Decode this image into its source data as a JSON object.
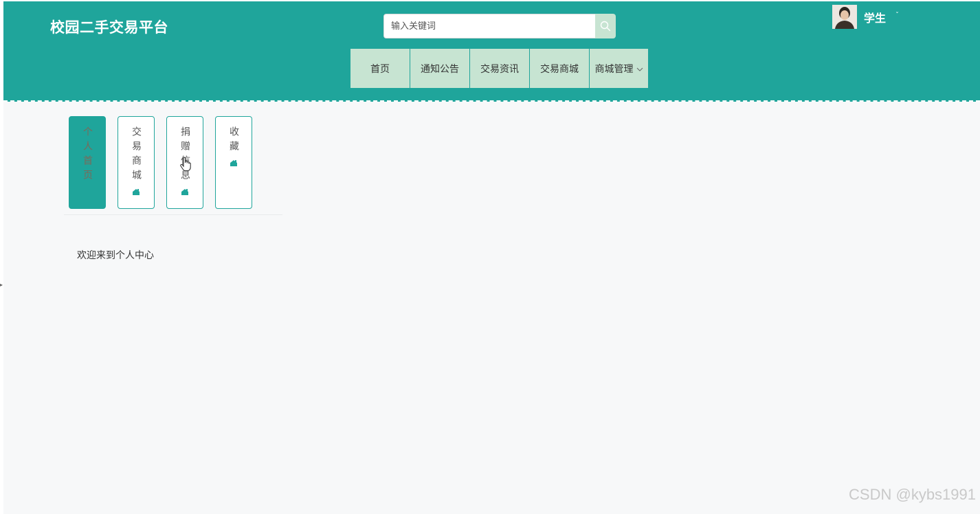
{
  "header": {
    "brand": "校园二手交易平台",
    "search": {
      "placeholder": "输入关键词",
      "value": ""
    },
    "user": {
      "name": "学生",
      "caret": "ˇ"
    }
  },
  "nav": {
    "items": [
      {
        "label": "首页"
      },
      {
        "label": "通知公告"
      },
      {
        "label": "交易资讯"
      },
      {
        "label": "交易商城"
      },
      {
        "label": "商城管理",
        "has_dropdown": true
      }
    ],
    "dropdown_caret": "﹀"
  },
  "tabs": [
    {
      "label": "个人首页",
      "active": true,
      "icon": null
    },
    {
      "label": "交易商城",
      "active": false,
      "icon": "house-icon"
    },
    {
      "label": "捐赠信息",
      "active": false,
      "icon": "house-icon"
    },
    {
      "label": "收藏",
      "active": false,
      "icon": "house-icon"
    }
  ],
  "main": {
    "welcome": "欢迎来到个人中心"
  },
  "watermark": "CSDN @kybs1991",
  "colors": {
    "primary": "#1fa59b",
    "nav_bg": "#c7e4d2",
    "page_bg": "#f7f8f9"
  }
}
